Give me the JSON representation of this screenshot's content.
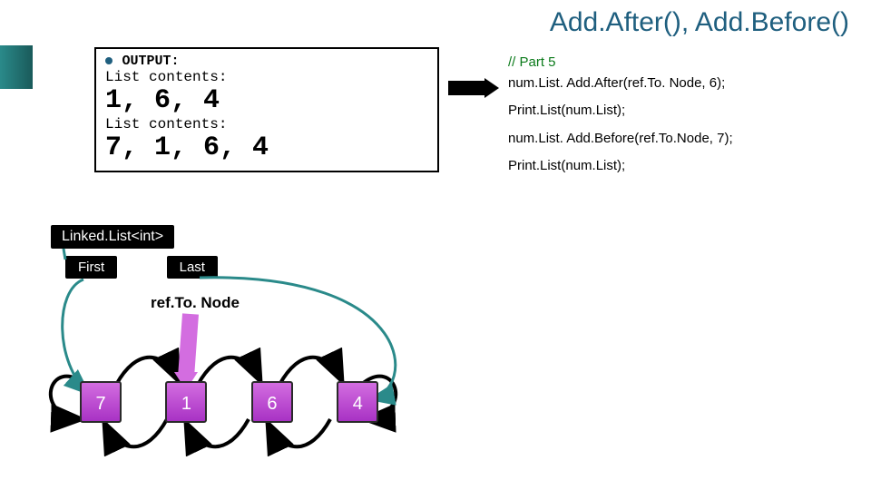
{
  "title": "Add.After(), Add.Before()",
  "output": {
    "heading": "OUTPUT:",
    "label1": "List contents:",
    "vals1": "1, 6, 4",
    "label2": "List contents:",
    "vals2": "7, 1, 6, 4"
  },
  "code": {
    "comment": "// Part 5",
    "l1": "num.List. Add.After(ref.To. Node, 6);",
    "l2": "Print.List(num.List);",
    "l3": "num.List. Add.Before(ref.To.Node, 7);",
    "l4": "Print.List(num.List);"
  },
  "labels": {
    "linkedlist": "Linked.List<int>",
    "first": "First",
    "last": "Last",
    "refnode": "ref.To. Node"
  },
  "nodes": [
    "7",
    "1",
    "6",
    "4"
  ],
  "colors": {
    "accent": "#1f5f7f",
    "comment_green": "#0a7a1a",
    "node_purple": "#a832c4"
  }
}
